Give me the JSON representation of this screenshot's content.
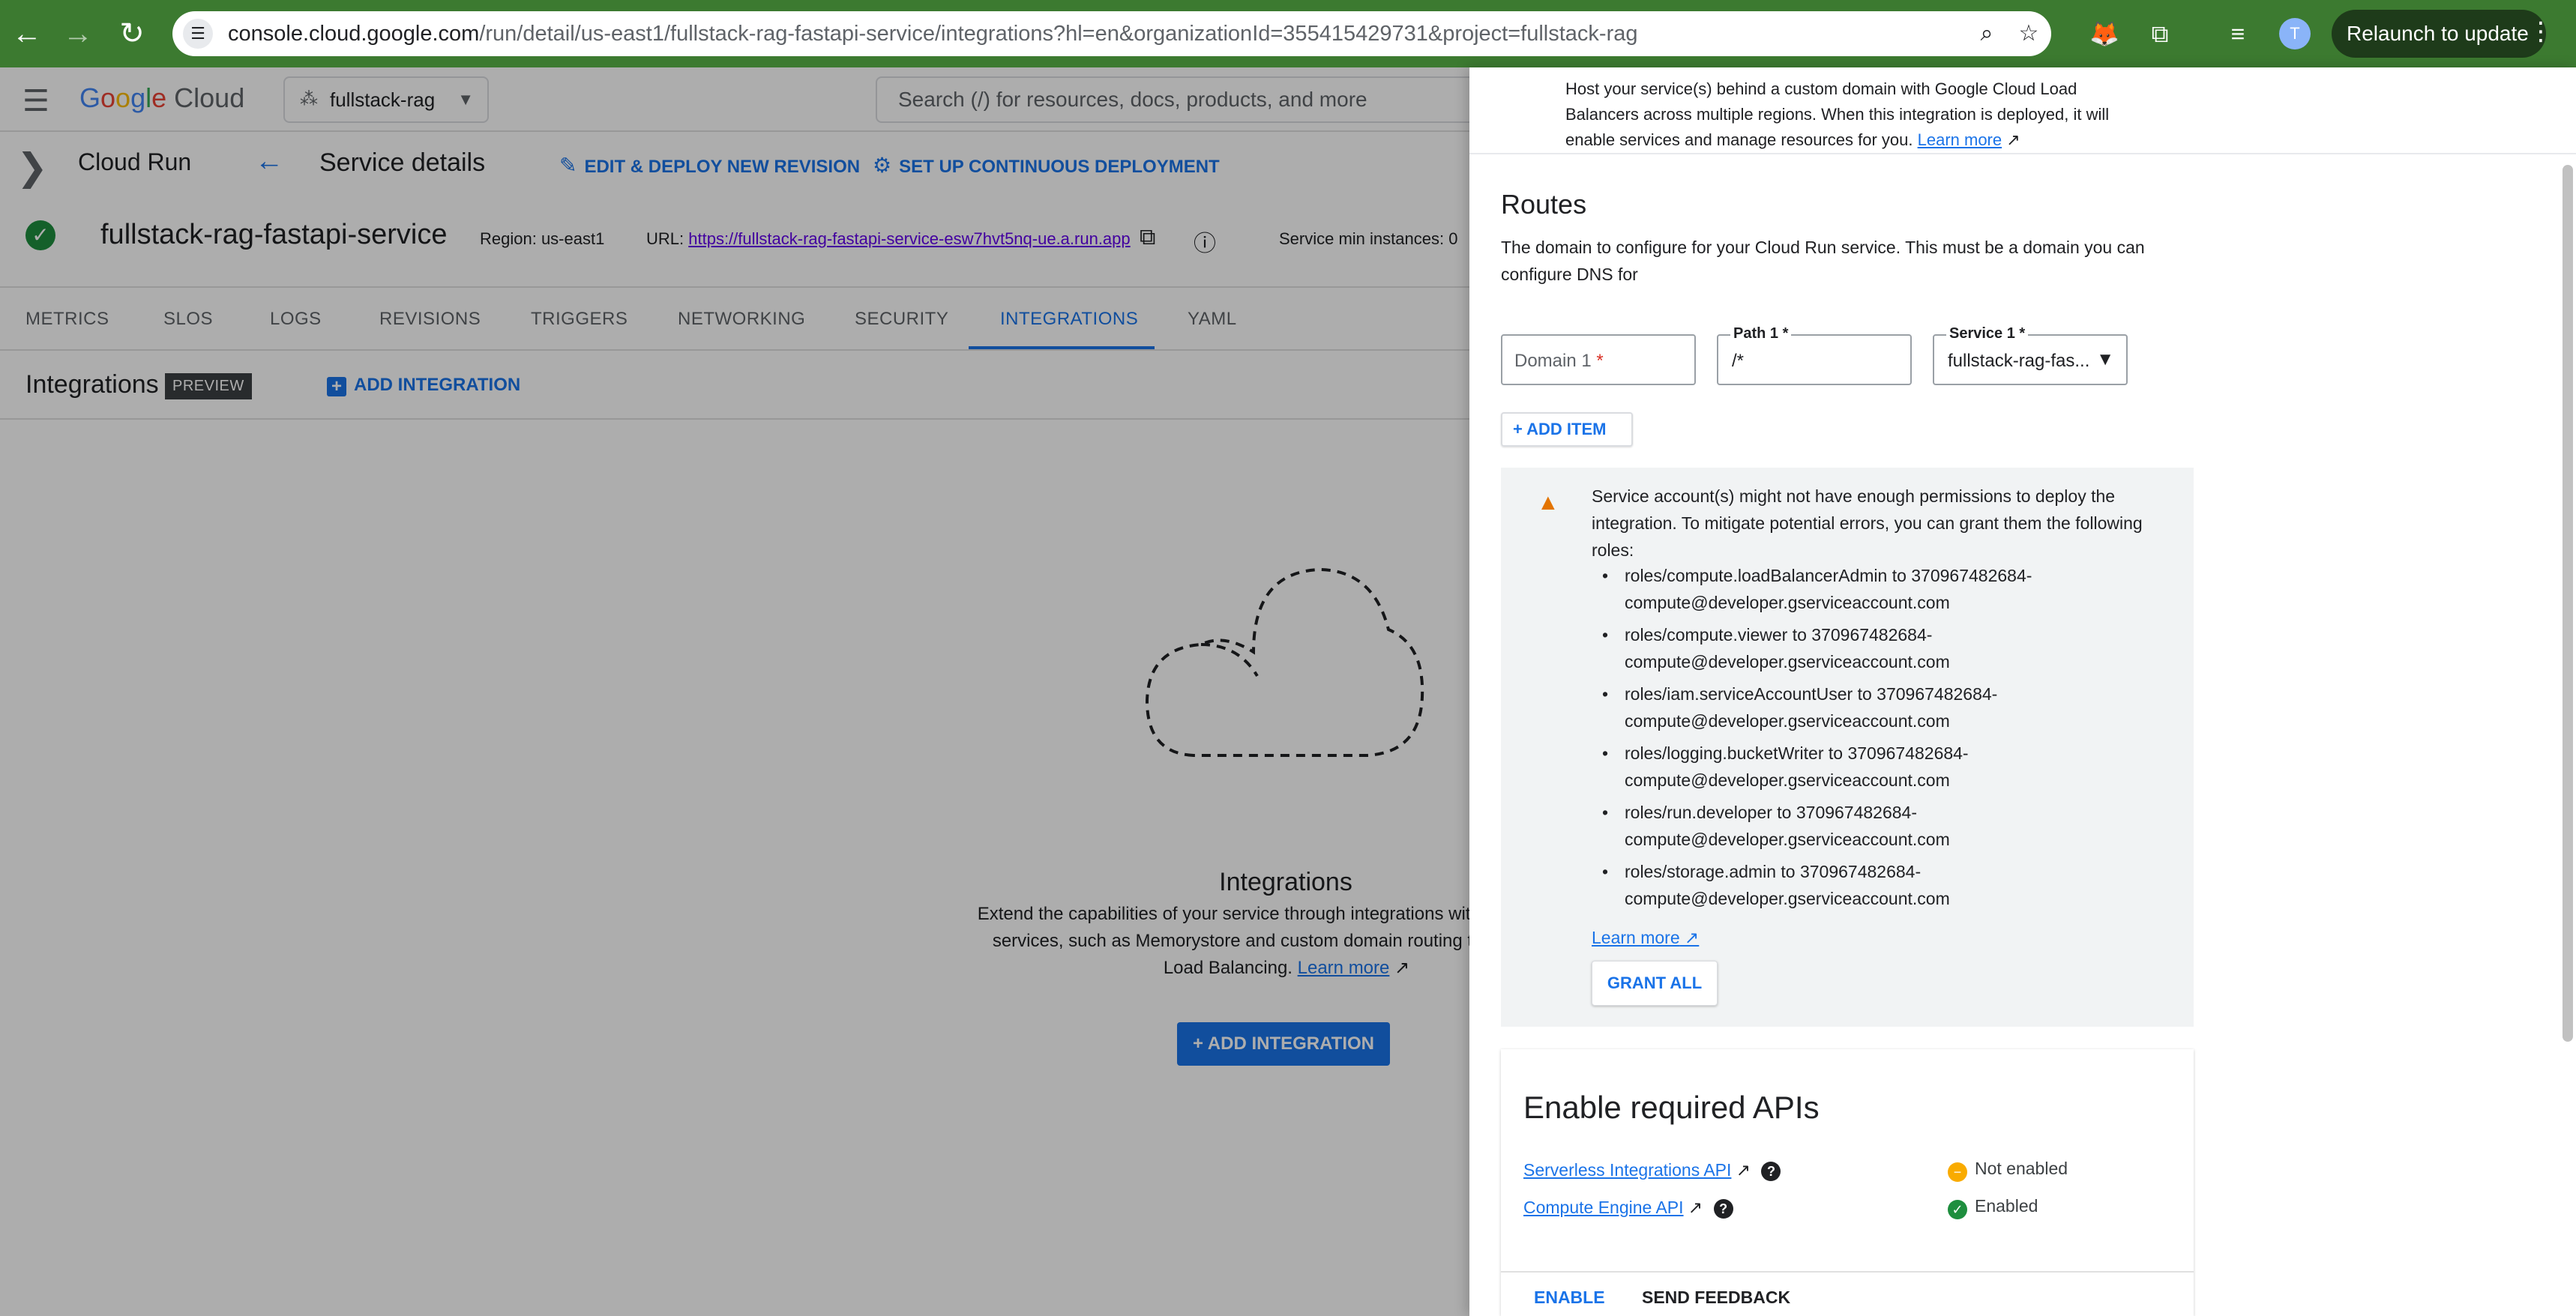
{
  "browser": {
    "url_host": "console.cloud.google.com",
    "url_path": "/run/detail/us-east1/fullstack-rag-fastapi-service/integrations?hl=en&organizationId=355415429731&project=fullstack-rag",
    "profile_initial": "T",
    "relaunch_label": "Relaunch to update"
  },
  "header": {
    "logo_google": [
      "G",
      "o",
      "o",
      "g",
      "l",
      "e"
    ],
    "logo_cloud": "Cloud",
    "project": "fullstack-rag",
    "search_placeholder": "Search (/) for resources, docs, products, and more"
  },
  "service_bar": {
    "product": "Cloud Run",
    "page_title": "Service details",
    "edit_deploy": "EDIT & DEPLOY NEW REVISION",
    "continuous_deploy": "SET UP CONTINUOUS DEPLOYMENT"
  },
  "service": {
    "name": "fullstack-rag-fastapi-service",
    "region": "Region: us-east1",
    "url_label": "URL:",
    "url": "https://fullstack-rag-fastapi-service-esw7hvt5nq-ue.a.run.app",
    "min_instances": "Service min instances: 0"
  },
  "tabs": [
    "METRICS",
    "SLOS",
    "LOGS",
    "REVISIONS",
    "TRIGGERS",
    "NETWORKING",
    "SECURITY",
    "INTEGRATIONS",
    "YAML"
  ],
  "integrations": {
    "title": "Integrations",
    "badge": "PREVIEW",
    "add_link": "ADD INTEGRATION",
    "empty_title": "Integrations",
    "empty_desc": "Extend the capabilities of your service through integrations with Google Cloud services, such as Memorystore and custom domain routing through Cloud Load Balancing.",
    "empty_learn_more": "Learn more",
    "empty_button": "ADD INTEGRATION"
  },
  "panel": {
    "intro": "Host your service(s) behind a custom domain with Google Cloud Load Balancers across multiple regions. When this integration is deployed, it will enable services and manage resources for you.",
    "intro_learn_more": "Learn more",
    "routes_title": "Routes",
    "routes_desc": "The domain to configure for your Cloud Run service. This must be a domain you can configure DNS for",
    "domain_placeholder": "Domain 1",
    "path_label": "Path 1 *",
    "path_value": "/*",
    "service_label": "Service 1 *",
    "service_value": "fullstack-rag-fas...",
    "add_item": "ADD ITEM",
    "warning": "Service account(s) might not have enough permissions to deploy the integration. To mitigate potential errors, you can grant them the following roles:",
    "roles": [
      "roles/compute.loadBalancerAdmin to 370967482684-compute@developer.gserviceaccount.com",
      "roles/compute.viewer to 370967482684-compute@developer.gserviceaccount.com",
      "roles/iam.serviceAccountUser to 370967482684-compute@developer.gserviceaccount.com",
      "roles/logging.bucketWriter to 370967482684-compute@developer.gserviceaccount.com",
      "roles/run.developer to 370967482684-compute@developer.gserviceaccount.com",
      "roles/storage.admin to 370967482684-compute@developer.gserviceaccount.com"
    ],
    "warn_learn_more": "Learn more",
    "grant_all": "GRANT ALL",
    "apis_title": "Enable required APIs",
    "apis": [
      {
        "name": "Serverless Integrations API",
        "status": "Not enabled",
        "color": "#f9ab00"
      },
      {
        "name": "Compute Engine API",
        "status": "Enabled",
        "color": "#1e8e3e"
      }
    ],
    "enable_button": "ENABLE",
    "feedback_button": "SEND FEEDBACK"
  }
}
